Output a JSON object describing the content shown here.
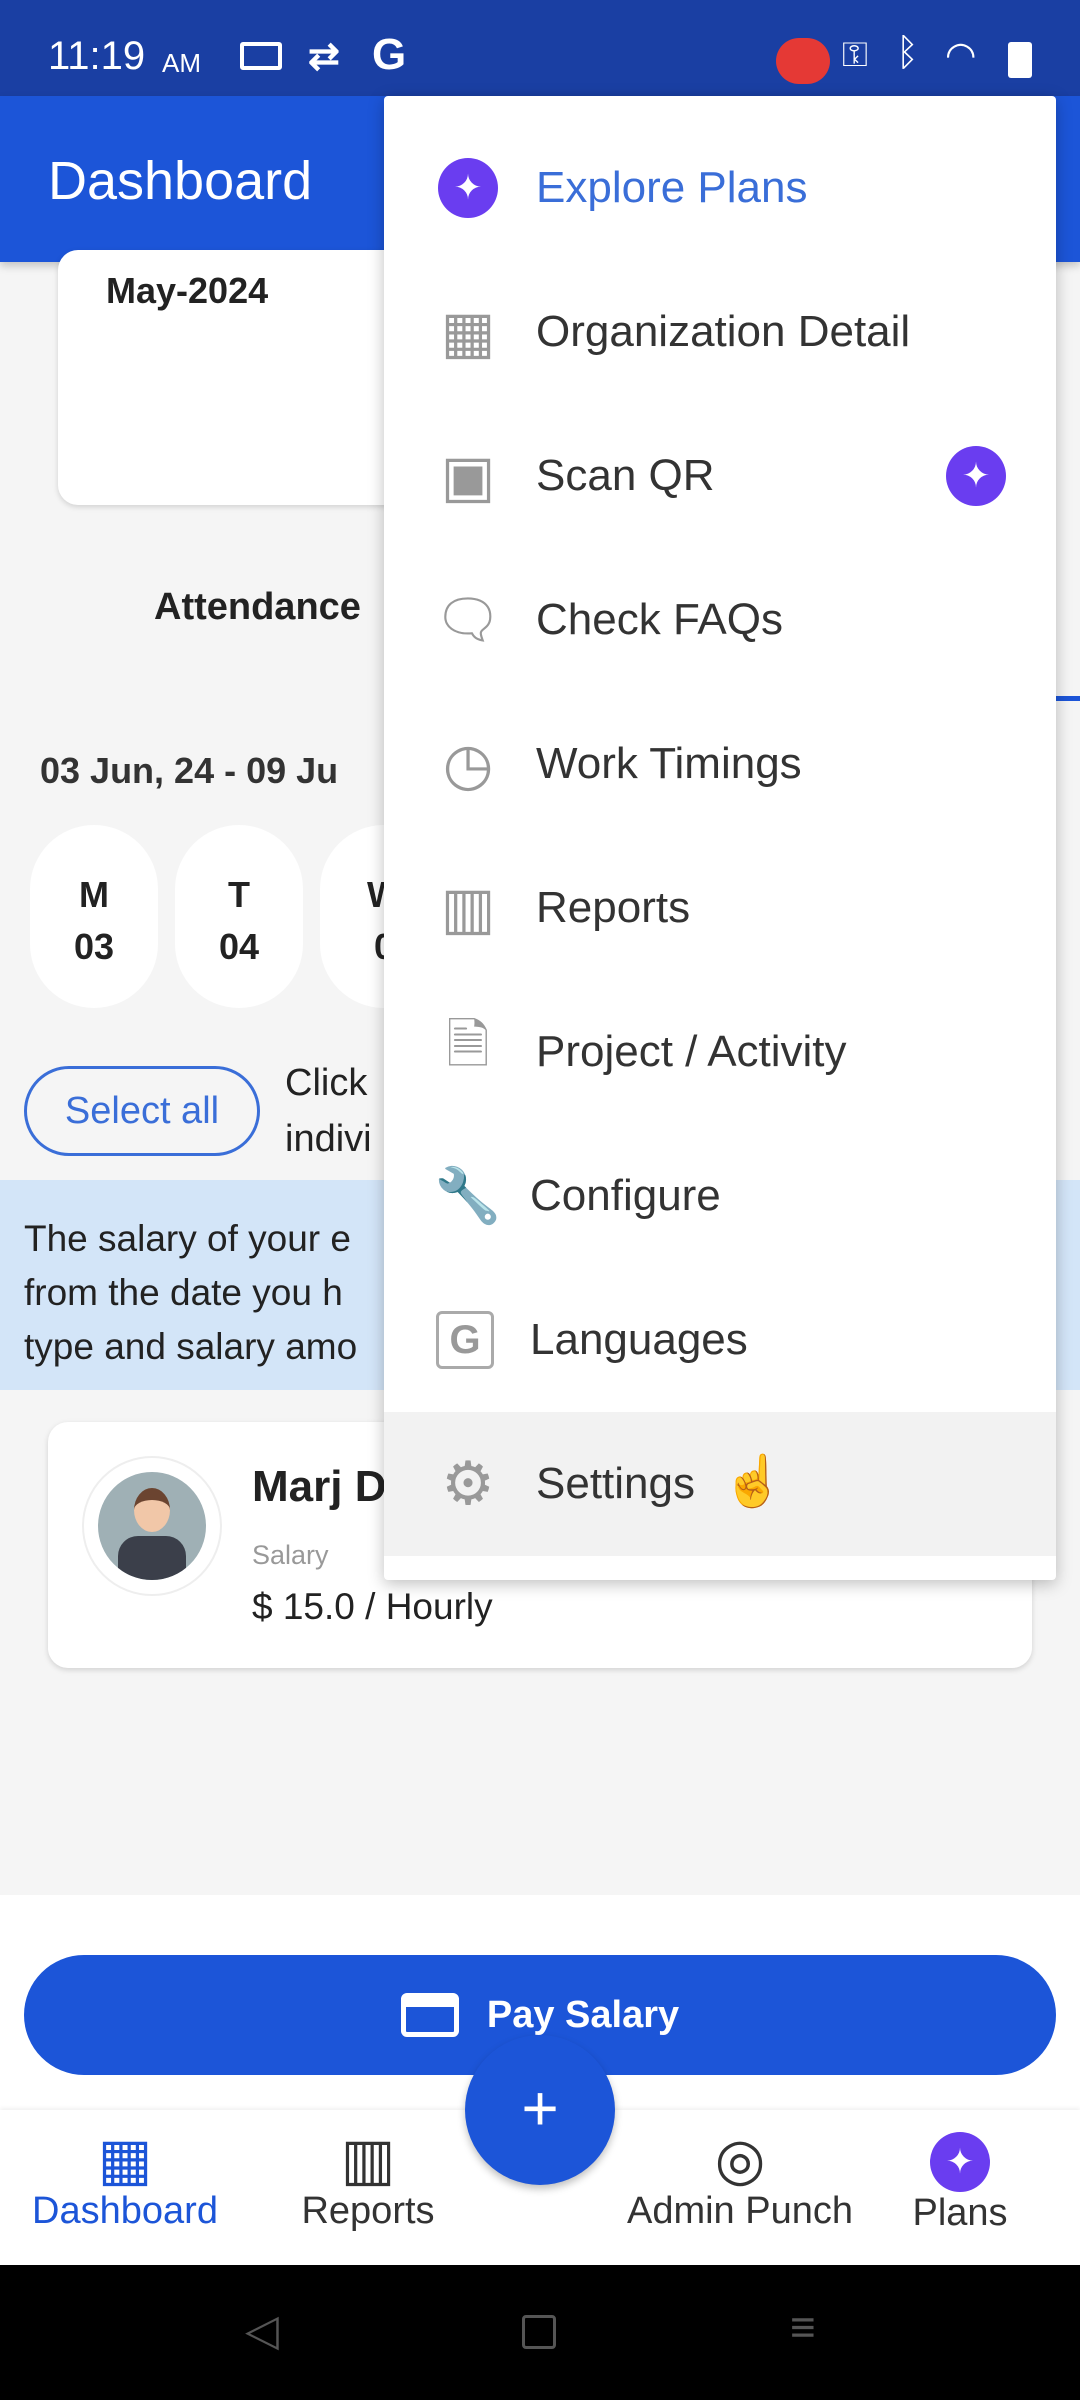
{
  "status_bar": {
    "time": "11:19",
    "ampm": "AM"
  },
  "app_bar": {
    "title": "Dashboard"
  },
  "background": {
    "month": "May-2024",
    "attendance_label": "Attendance",
    "date_range": "03 Jun, 24 - 09 Ju",
    "days": [
      {
        "d": "M",
        "n": "03"
      },
      {
        "d": "T",
        "n": "04"
      },
      {
        "d": "W",
        "n": "0"
      }
    ],
    "select_all": "Select all",
    "hint_line1": "Click",
    "hint_line2": "indivi",
    "info_lines": [
      "The salary of your e",
      "from the date you h",
      "type and salary amo"
    ],
    "employee": {
      "name": "Marj D",
      "salary_label": "Salary",
      "salary": "$ 15.0 / Hourly"
    },
    "pay_salary": "Pay Salary"
  },
  "menu": {
    "items": [
      {
        "label": "Explore Plans",
        "icon": "sparkle-icon"
      },
      {
        "label": "Organization Detail",
        "icon": "building-icon"
      },
      {
        "label": "Scan QR",
        "icon": "qr-icon",
        "badge": "sparkle-icon"
      },
      {
        "label": "Check FAQs",
        "icon": "chat-icon"
      },
      {
        "label": "Work Timings",
        "icon": "clock-icon"
      },
      {
        "label": "Reports",
        "icon": "chart-icon"
      },
      {
        "label": "Project / Activity",
        "icon": "document-add-icon"
      },
      {
        "label": "Configure",
        "icon": "wrench-icon"
      },
      {
        "label": "Languages",
        "icon": "translate-icon"
      },
      {
        "label": "Settings",
        "icon": "gear-icon"
      }
    ]
  },
  "bottom_nav": [
    {
      "label": "Dashboard",
      "active": true
    },
    {
      "label": "Reports"
    },
    {
      "label": "Admin Punch"
    },
    {
      "label": "Plans"
    }
  ],
  "colors": {
    "primary": "#1c55d8",
    "plans": "#6a3df0",
    "info_band": "#d3e5f8"
  }
}
